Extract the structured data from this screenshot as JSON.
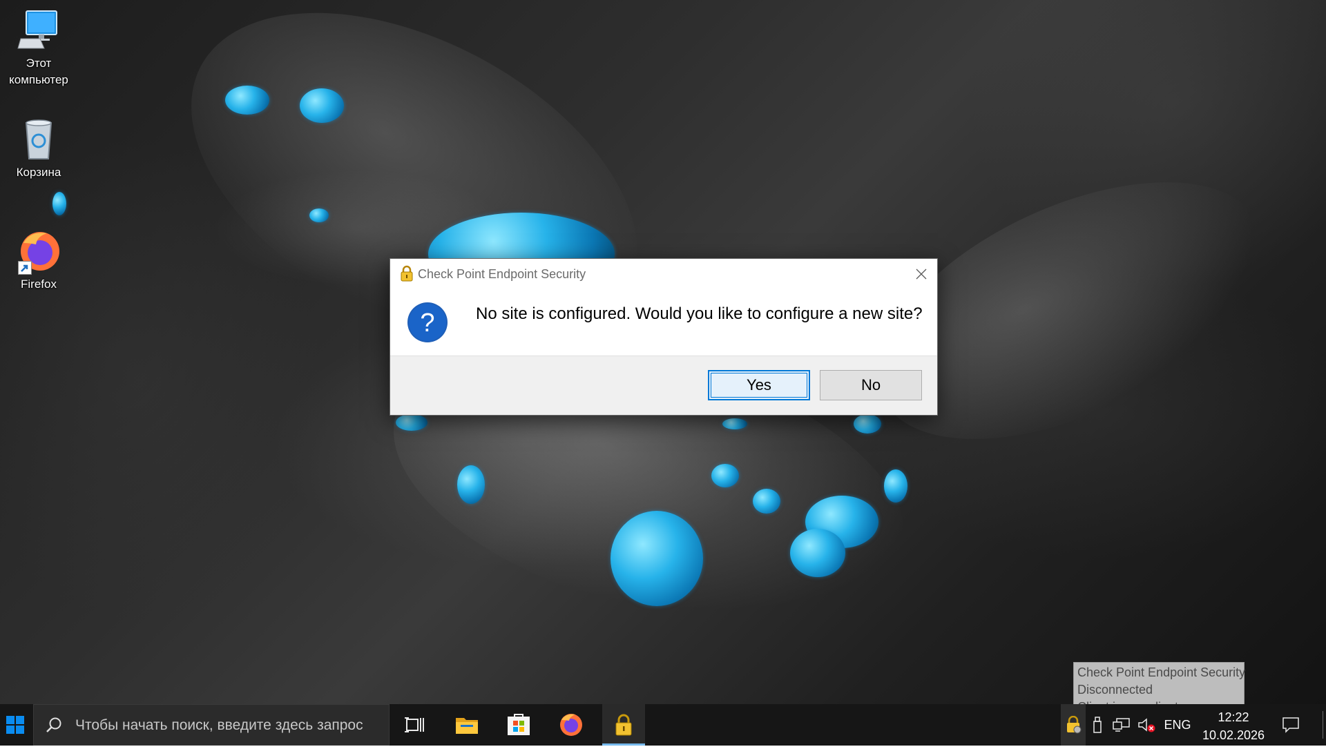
{
  "desktop": {
    "icons": [
      {
        "label_line1": "Этот",
        "label_line2": "компьютер",
        "icon": "computer-icon"
      },
      {
        "label": "Корзина",
        "icon": "recycle-bin-icon"
      },
      {
        "label": "Firefox",
        "icon": "firefox-icon"
      }
    ]
  },
  "dialog": {
    "title": "Check Point Endpoint Security",
    "message": "No site is configured. Would you like to configure a new site?",
    "yes_label": "Yes",
    "no_label": "No",
    "icon": "question-icon"
  },
  "tooltip": {
    "lines": [
      "Check Point Endpoint Security",
      "Disconnected",
      "Client is compliant"
    ]
  },
  "taskbar": {
    "search_placeholder": "Чтобы начать поиск, введите здесь запрос",
    "apps": [
      "task-view-icon",
      "file-explorer-icon",
      "microsoft-store-icon",
      "firefox-icon",
      "check-point-lock-icon"
    ],
    "active_app": "check-point-lock-icon",
    "language": "ENG",
    "time": "12:22",
    "date": "10.02.2026"
  },
  "colors": {
    "accent": "#0078d7",
    "active_indicator": "#76b9ed",
    "dialog_footer": "#f0f0f0",
    "taskbar": "#161616"
  }
}
